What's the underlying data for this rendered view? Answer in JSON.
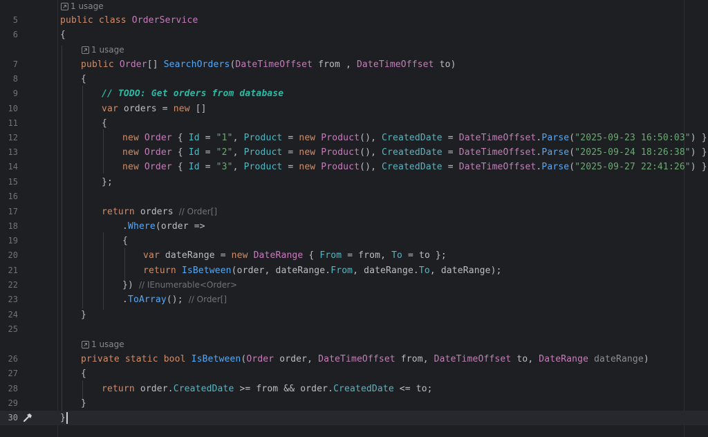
{
  "editor": {
    "usage_label": "1 usage",
    "line_numbers": [
      "5",
      "6",
      "7",
      "8",
      "9",
      "10",
      "11",
      "12",
      "13",
      "14",
      "15",
      "16",
      "17",
      "18",
      "19",
      "20",
      "21",
      "22",
      "23",
      "24",
      "25",
      "26",
      "27",
      "28",
      "29",
      "30"
    ],
    "inlay_hints": {
      "orders_type": "// Order[]",
      "where_type": "// IEnumerable<Order>",
      "toarray_type": "// Order[]"
    },
    "colors": {
      "background": "#1e1f22",
      "keyword": "#cf8e6d",
      "type": "#c77dbb",
      "method": "#56a8f5",
      "string": "#6aab73"
    },
    "lines": {
      "l5_kw1": "public",
      "l5_kw2": "class",
      "l5_name": "OrderService",
      "l6": "{",
      "l7_kw": "public",
      "l7_type": "Order",
      "l7_arr": "[]",
      "l7_method": "SearchOrders",
      "l7_p1type": "DateTimeOffset",
      "l7_p1": "from",
      "l7_p2type": "DateTimeOffset",
      "l7_p2": "to",
      "l8": "{",
      "l9": "// TODO: Get orders from database",
      "l10_var": "var",
      "l10_name": "orders",
      "l10_new": "new",
      "l11": "{",
      "order_rows": [
        {
          "id": "\"1\"",
          "date": "\"2025-09-23 16:50:03\"",
          "tail": ") },"
        },
        {
          "id": "\"2\"",
          "date": "\"2025-09-24 18:26:38\"",
          "tail": ") },"
        },
        {
          "id": "\"3\"",
          "date": "\"2025-09-27 22:41:26\"",
          "tail": ") }"
        }
      ],
      "l15": "};",
      "l17_return": "return",
      "l17_name": "orders",
      "l18_method": "Where",
      "l18_param": "order",
      "l19": "{",
      "l20_var": "var",
      "l20_name": "dateRange",
      "l20_new": "new",
      "l20_type": "DateRange",
      "l20_from": "From",
      "l20_fromval": "from",
      "l20_to": "To",
      "l20_toval": "to",
      "l21_return": "return",
      "l21_method": "IsBetween",
      "l22": "})",
      "l23_method": "ToArray",
      "l24": "}",
      "l26_kw1": "private",
      "l26_kw2": "static",
      "l26_kw3": "bool",
      "l26_method": "IsBetween",
      "l26_t1": "Order",
      "l26_p1": "order",
      "l26_t2": "DateTimeOffset",
      "l26_p2": "from",
      "l26_t3": "DateTimeOffset",
      "l26_p3": "to",
      "l26_t4": "DateRange",
      "l26_p4": "dateRange",
      "l27": "{",
      "l28_return": "return",
      "l29": "}",
      "l30": "}"
    }
  }
}
